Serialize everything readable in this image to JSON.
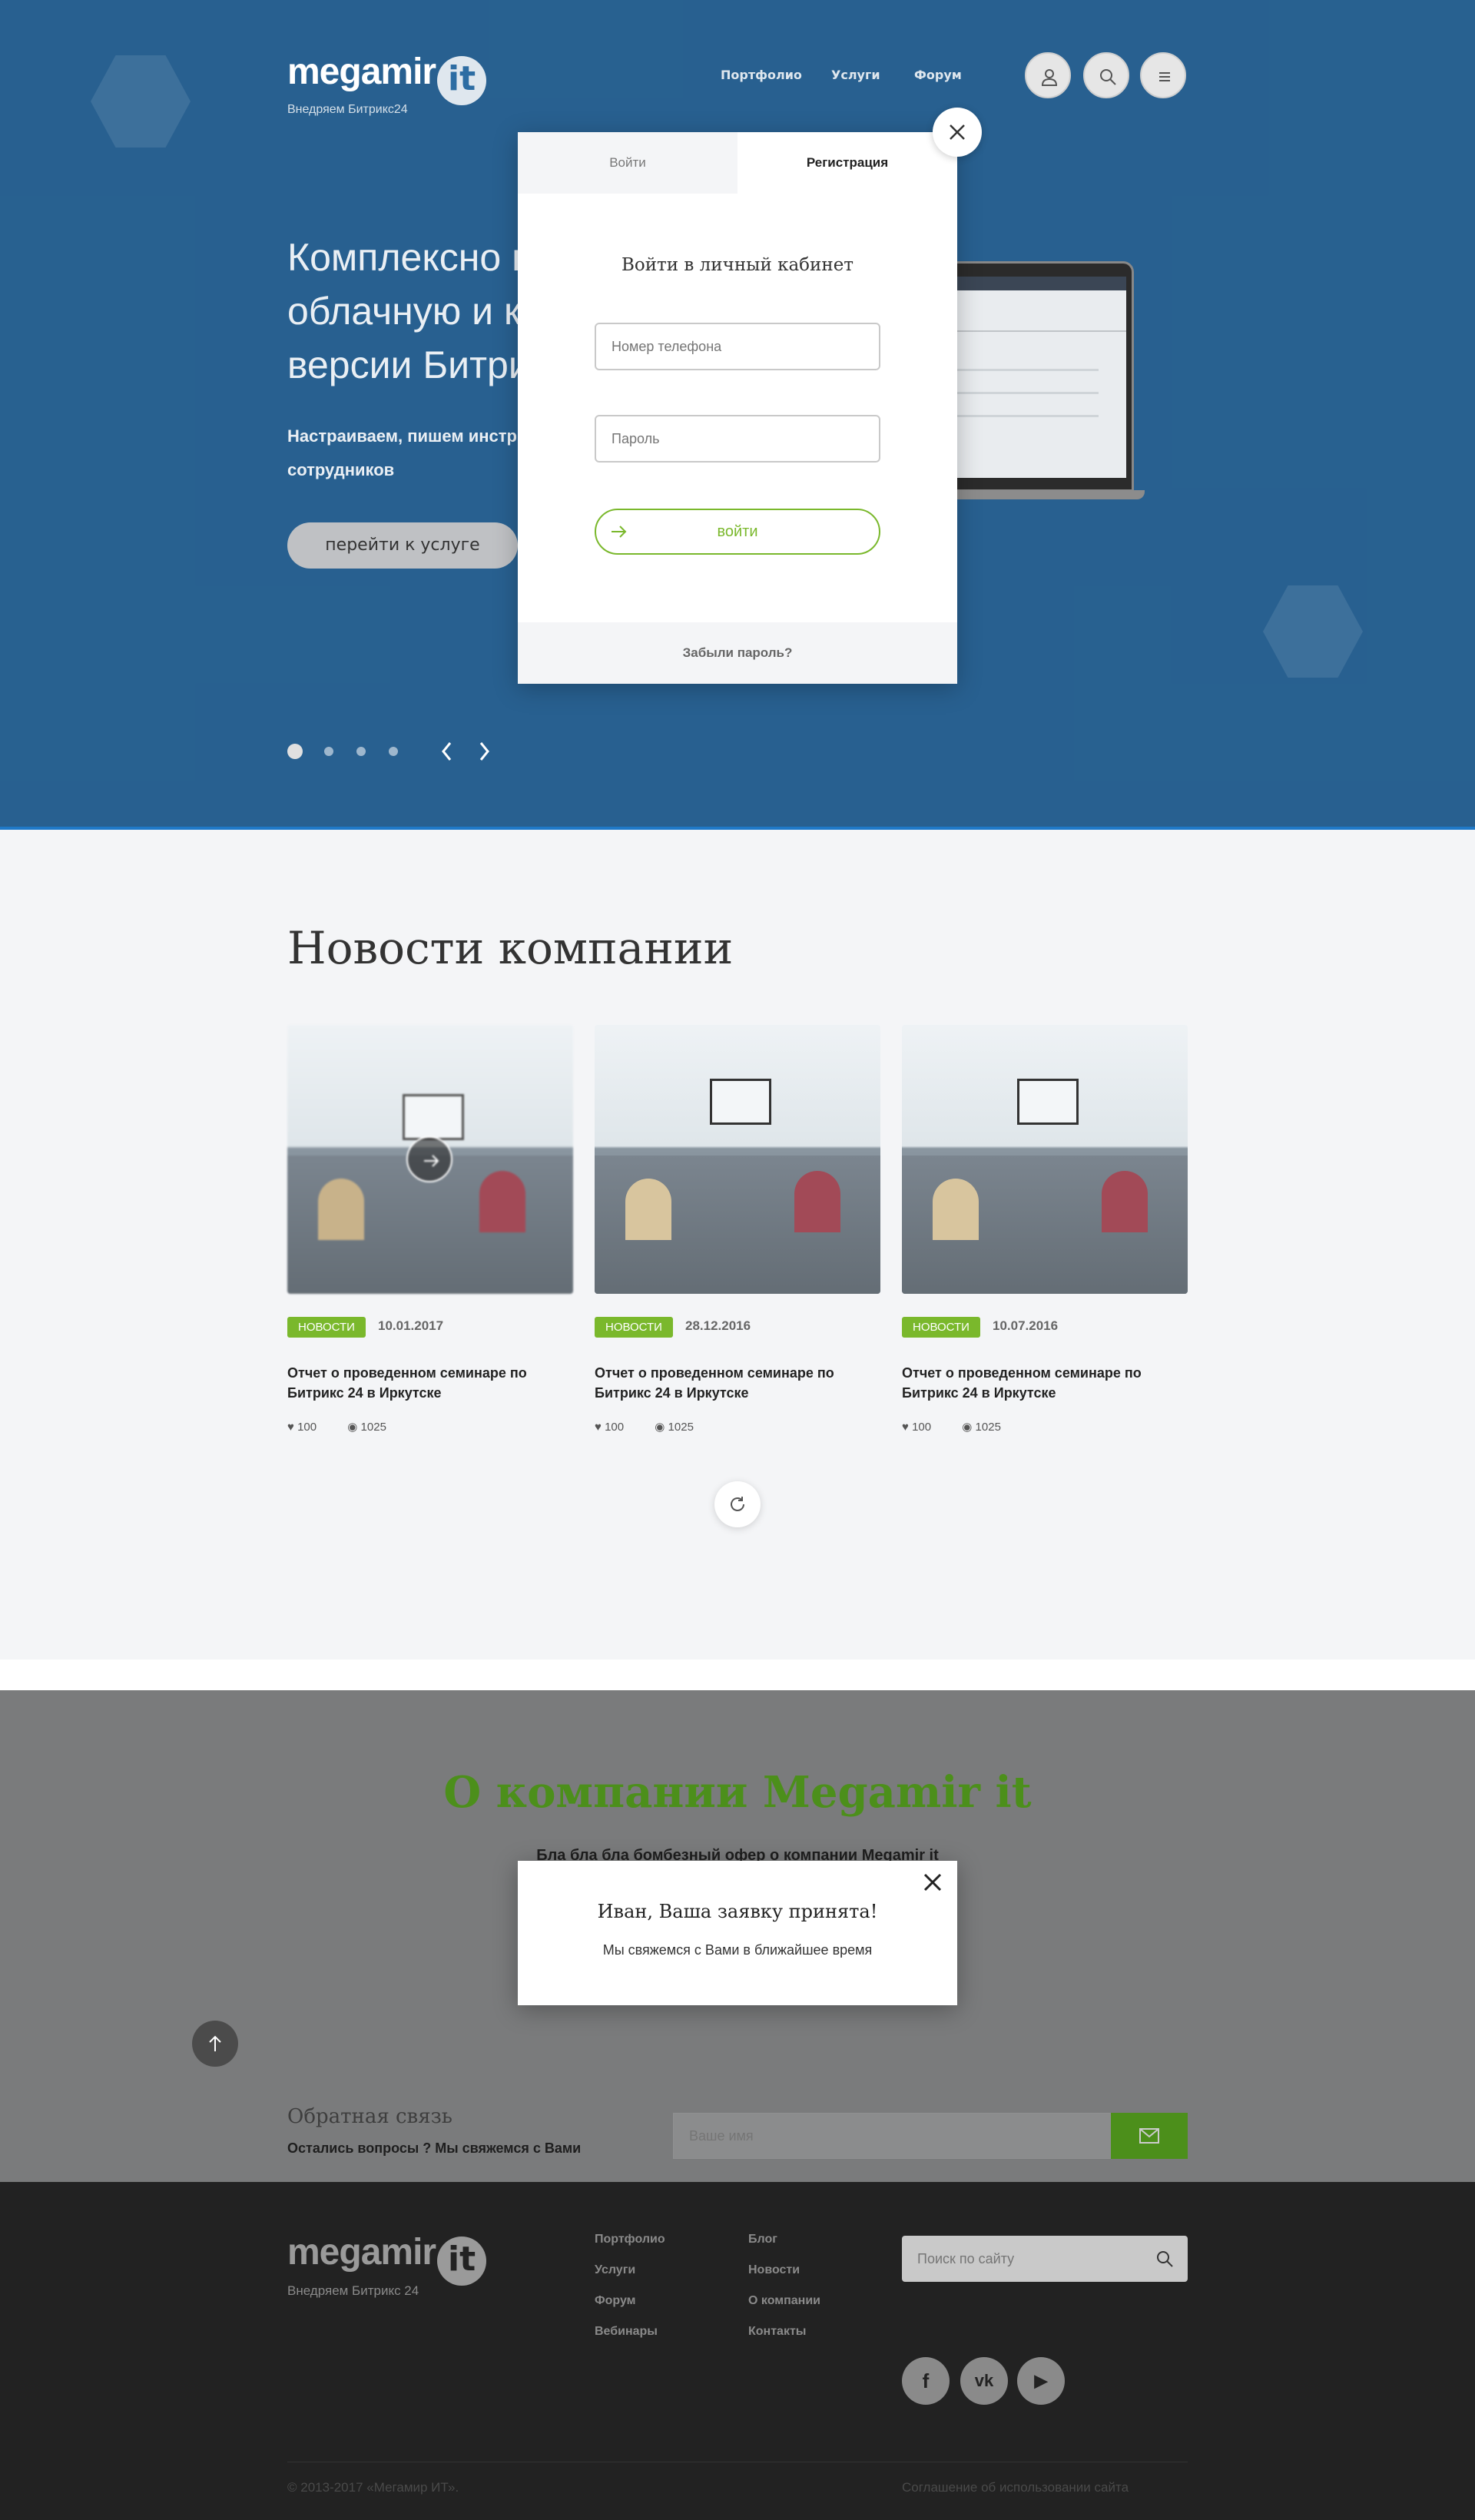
{
  "header": {
    "logo_word": "megamir",
    "logo_suffix": "it",
    "tagline": "Внедряем Битрикс24",
    "nav": [
      "Портфолио",
      "Услуги",
      "Форум"
    ],
    "icons": [
      "user-icon",
      "search-icon",
      "menu-icon"
    ]
  },
  "hero": {
    "title_lines": [
      "Комплексно в",
      "облачную и к",
      "версии Битри"
    ],
    "subtitle_lines": [
      "Настраиваем, пишем инстр",
      "сотрудников"
    ],
    "button": "перейти к услуге",
    "slides_count": 4,
    "active_slide": 1
  },
  "login_modal": {
    "tab_login": "Войти",
    "tab_register": "Регистрация",
    "heading": "Войти в личный кабинет",
    "phone_placeholder": "Номер телефона",
    "password_placeholder": "Пароль",
    "submit": "войти",
    "forgot": "Забыли пароль?"
  },
  "news": {
    "title": "Новости компании",
    "items": [
      {
        "badge": "НОВОСТИ",
        "date": "10.01.2017",
        "title": "Отчет о проведенном семинаре по Битрикс 24 в Иркутске",
        "likes": "100",
        "views": "1025"
      },
      {
        "badge": "НОВОСТИ",
        "date": "28.12.2016",
        "title": "Отчет о проведенном семинаре по Битрикс 24 в Иркутске",
        "likes": "100",
        "views": "1025"
      },
      {
        "badge": "НОВОСТИ",
        "date": "10.07.2016",
        "title": "Отчет о проведенном семинаре по Битрикс 24 в Иркутске",
        "likes": "100",
        "views": "1025"
      }
    ]
  },
  "about": {
    "title": "О компании Megamir it",
    "subtitle": "Бла бла бла бомбезный офер о компании Megamir it"
  },
  "success_modal": {
    "heading": "Иван, Ваша заявку принята!",
    "text": "Мы свяжемся с Вами в ближайшее время"
  },
  "feedback": {
    "title": "Обратная связь",
    "subtitle": "Остались вопросы ? Мы свяжемся с Вами",
    "name_placeholder": "Ваше имя"
  },
  "footer": {
    "logo_word": "megamir",
    "logo_suffix": "it",
    "tagline": "Внедряем Битрикс 24",
    "col1": [
      "Портфолио",
      "Услуги",
      "Форум",
      "Вебинары"
    ],
    "col2": [
      "Блог",
      "Новости",
      "О компании",
      "Контакты"
    ],
    "search_placeholder": "Поиск по сайту",
    "social": [
      "f",
      "vk",
      "▶"
    ],
    "copyright": "© 2013-2017 «Мегамир ИТ».",
    "agreement": "Соглашение об использовании сайта"
  },
  "colors": {
    "hero_bg": "#2d6da3",
    "accent_green": "#7ab82c",
    "footer_bg": "#222222"
  }
}
